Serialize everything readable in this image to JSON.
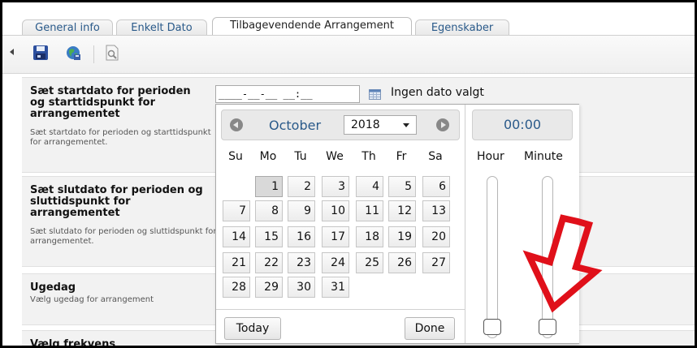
{
  "tabs": [
    {
      "label": "General info"
    },
    {
      "label": "Enkelt Dato"
    },
    {
      "label": "Tilbagevendende Arrangement"
    },
    {
      "label": "Egenskaber"
    }
  ],
  "toolbar": {
    "icons": [
      "save-icon",
      "globe-icon",
      "preview-icon"
    ]
  },
  "form": {
    "start": {
      "title": "Sæt startdato for perioden og starttidspunkt for arrangementet",
      "desc": "Sæt startdato for perioden og starttidspunkt for arrangementet."
    },
    "end": {
      "title": "Sæt slutdato for perioden og sluttidspunkt for arrangementet",
      "desc": "Sæt slutdato for perioden og sluttidspunkt for arrangementet."
    },
    "weekday": {
      "title": "Ugedag",
      "desc": "Vælg ugedag for arrangement"
    },
    "frequency": {
      "title": "Vælg frekvens"
    },
    "date_input_value": "____-__-__ __:__",
    "no_date_label": "Ingen dato valgt"
  },
  "datepicker": {
    "month": "October",
    "year": "2018",
    "weekdays": [
      "Su",
      "Mo",
      "Tu",
      "We",
      "Th",
      "Fr",
      "Sa"
    ],
    "weeks": [
      [
        "",
        "1",
        "2",
        "3",
        "4",
        "5",
        "6"
      ],
      [
        "7",
        "8",
        "9",
        "10",
        "11",
        "12",
        "13"
      ],
      [
        "14",
        "15",
        "16",
        "17",
        "18",
        "19",
        "20"
      ],
      [
        "21",
        "22",
        "23",
        "24",
        "25",
        "26",
        "27"
      ],
      [
        "28",
        "29",
        "30",
        "31",
        "",
        "",
        ""
      ]
    ],
    "current_day": "1",
    "today_label": "Today",
    "done_label": "Done",
    "time": "00:00",
    "hour_label": "Hour",
    "minute_label": "Minute",
    "hour_value": 0,
    "minute_value": 0
  },
  "colors": {
    "accent_text": "#2a5a8a",
    "annotation_arrow": "#e0101a"
  }
}
